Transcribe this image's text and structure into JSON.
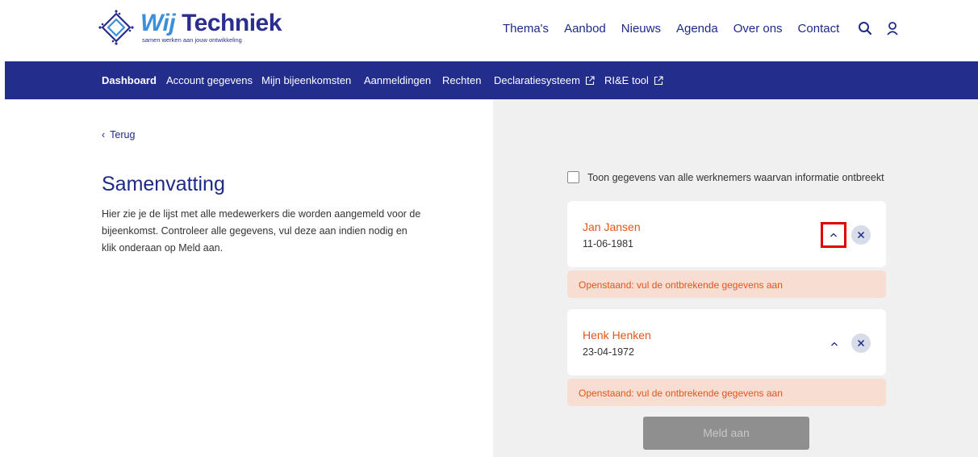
{
  "brand": {
    "name_part1": "Wij",
    "name_part2": "Techniek",
    "tagline": "samen werken aan jouw ontwikkeling"
  },
  "top_nav": {
    "items": [
      "Thema's",
      "Aanbod",
      "Nieuws",
      "Agenda",
      "Over ons",
      "Contact"
    ],
    "icons": [
      "search-icon",
      "user-icon"
    ]
  },
  "sub_nav": {
    "items": [
      {
        "label": "Dashboard",
        "active": true
      },
      {
        "label": "Account gegevens"
      },
      {
        "label": "Mijn bijeenkomsten"
      },
      {
        "label": "Aanmeldingen"
      },
      {
        "label": "Rechten"
      },
      {
        "label": "Declaratiesysteem",
        "external": true
      },
      {
        "label": "RI&E tool",
        "external": true
      }
    ]
  },
  "back_link": "Terug",
  "summary": {
    "title": "Samenvatting",
    "description": "Hier zie je de lijst met alle medewerkers die worden aangemeld voor de bijeenkomst. Controleer alle gegevens, vul deze aan indien nodig en klik onderaan op Meld aan."
  },
  "filter": {
    "label": "Toon gegevens van alle werknemers waarvan informatie ontbreekt",
    "checked": false
  },
  "employees": [
    {
      "name": "Jan Jansen",
      "birthdate": "11-06-1981",
      "status": "Openstaand: vul de ontbrekende gegevens aan"
    },
    {
      "name": "Henk Henken",
      "birthdate": "23-04-1972",
      "status": "Openstaand: vul de ontbrekende gegevens aan"
    }
  ],
  "submit_label": "Meld aan",
  "colors": {
    "navy": "#232d8c",
    "accent_orange": "#e2561a",
    "warning_bg": "#f8ddd2",
    "highlight_red": "#e00000"
  }
}
